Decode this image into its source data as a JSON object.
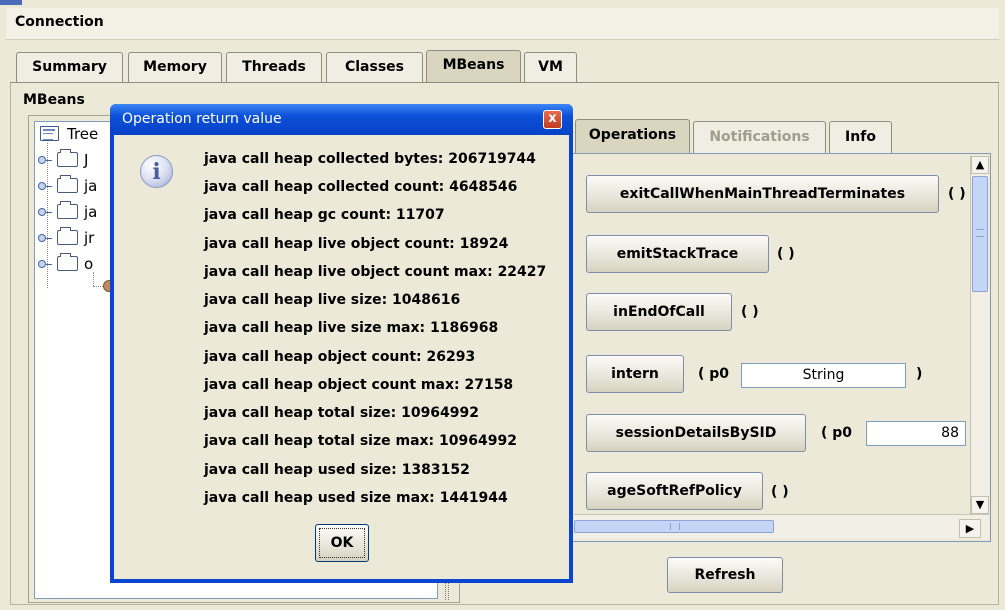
{
  "menu": {
    "connection": "Connection"
  },
  "tabs": [
    {
      "label": "Summary"
    },
    {
      "label": "Memory"
    },
    {
      "label": "Threads"
    },
    {
      "label": "Classes"
    },
    {
      "label": "MBeans",
      "selected": true
    },
    {
      "label": "VM"
    }
  ],
  "mbeans": {
    "section_label": "MBeans",
    "tree": {
      "root_label": "Tree",
      "items": [
        "J",
        "ja",
        "ja",
        "jr",
        "o"
      ]
    }
  },
  "right_panel": {
    "tabs": [
      {
        "label": "Operations",
        "selected": true
      },
      {
        "label": "Notifications",
        "disabled": true
      },
      {
        "label": "Info"
      }
    ],
    "operations": [
      {
        "name": "exitCallWhenMainThreadTerminates",
        "signature": "( )"
      },
      {
        "name": "emitStackTrace",
        "signature": "( )"
      },
      {
        "name": "inEndOfCall",
        "signature": "( )"
      },
      {
        "name": "intern",
        "param_label": "( p0",
        "param_value": "String",
        "closing": ")"
      },
      {
        "name": "sessionDetailsBySID",
        "param_label": "( p0",
        "param_value": "88"
      },
      {
        "name": "ageSoftRefPolicy",
        "signature": "( )"
      }
    ],
    "refresh_label": "Refresh"
  },
  "dialog": {
    "title": "Operation return value",
    "close_glyph": "x",
    "info_glyph": "i",
    "lines": [
      "java call heap collected bytes: 206719744",
      "java call heap collected count: 4648546",
      "java call heap gc count: 11707",
      "java call heap live object count: 18924",
      "java call heap live object count max: 22427",
      "java call heap live size: 1048616",
      "java call heap live size max: 1186968",
      "java call heap object count: 26293",
      "java call heap object count max: 27158",
      "java call heap total size: 10964992",
      "java call heap total size max: 10964992",
      "java call heap used size: 1383152",
      "java call heap used size max: 1441944"
    ],
    "ok_label": "OK"
  },
  "colors": {
    "title_bar_blue": "#0b4fd8",
    "window_bg": "#ece9d8",
    "disabled_text": "#a19d8c"
  },
  "icons": [
    "tree-root-icon",
    "tree-expand-handle-icon",
    "folder-icon",
    "mbean-bean-icon",
    "info-icon",
    "close-icon",
    "scroll-up-arrow-icon",
    "scroll-down-arrow-icon",
    "scroll-right-arrow-icon"
  ]
}
